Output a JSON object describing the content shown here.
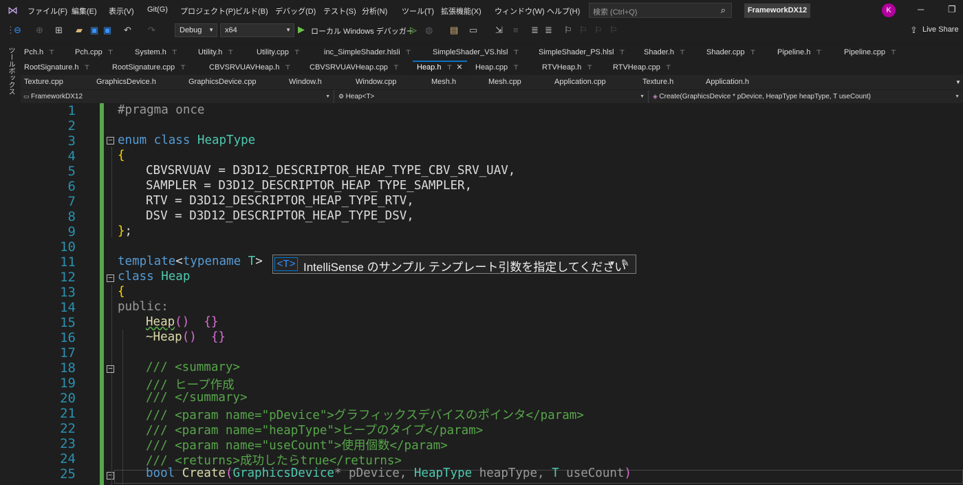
{
  "menu": {
    "items": [
      "ファイル(F)",
      "編集(E)",
      "表示(V)",
      "Git(G)",
      "プロジェクト(P)",
      "ビルド(B)",
      "デバッグ(D)",
      "テスト(S)",
      "分析(N)",
      "ツール(T)",
      "拡張機能(X)",
      "ウィンドウ(W)",
      "ヘルプ(H)"
    ],
    "search_placeholder": "検索 (Ctrl+Q)",
    "solution_name": "FrameworkDX12",
    "avatar_letter": "K"
  },
  "toolbar": {
    "config": "Debug",
    "platform": "x64",
    "run_label": "ローカル Windows デバッガー",
    "live_share": "Live Share"
  },
  "toolbox_label": "ツールボックス",
  "tabs": {
    "row1": [
      "Pch.h",
      "Pch.cpp",
      "System.h",
      "Utility.h",
      "Utility.cpp",
      "inc_SimpleShader.hlsli",
      "SimpleShader_VS.hlsl",
      "SimpleShader_PS.hlsl",
      "Shader.h",
      "Shader.cpp",
      "Pipeline.h",
      "Pipeline.cpp"
    ],
    "row2": [
      "RootSignature.h",
      "RootSignature.cpp",
      "CBVSRVUAVHeap.h",
      "CBVSRVUAVHeap.cpp",
      "Heap.h",
      "Heap.cpp",
      "RTVHeap.h",
      "RTVHeap.cpp"
    ],
    "row3": [
      "Texture.cpp",
      "GraphicsDevice.h",
      "GraphicsDevice.cpp",
      "Window.h",
      "Window.cpp",
      "Mesh.h",
      "Mesh.cpp",
      "Application.cpp",
      "Texture.h",
      "Application.h"
    ],
    "active": "Heap.h"
  },
  "navbar": {
    "project": "FrameworkDX12",
    "scope": "Heap<T>",
    "member": "Create(GraphicsDevice * pDevice, HeapType heapType, T useCount)"
  },
  "editor": {
    "line_numbers": [
      "1",
      "2",
      "3",
      "4",
      "5",
      "6",
      "7",
      "8",
      "9",
      "10",
      "11",
      "12",
      "13",
      "14",
      "15",
      "16",
      "17",
      "18",
      "19",
      "20",
      "21",
      "22",
      "23",
      "24",
      "25"
    ],
    "lines": {
      "l1": "#pragma once",
      "l3_kw": "enum class ",
      "l3_name": "HeapType",
      "l4": "{",
      "l5": "CBVSRVUAV = D3D12_DESCRIPTOR_HEAP_TYPE_CBV_SRV_UAV,",
      "l6": "SAMPLER = D3D12_DESCRIPTOR_HEAP_TYPE_SAMPLER,",
      "l7": "RTV = D3D12_DESCRIPTOR_HEAP_TYPE_RTV,",
      "l8": "DSV = D3D12_DESCRIPTOR_HEAP_TYPE_DSV,",
      "l9_brace": "}",
      "l9_semi": ";",
      "l11_kw1": "template",
      "l11_lt": "<",
      "l11_kw2": "typename ",
      "l11_t": "T",
      "l11_gt": ">",
      "l12_kw": "class ",
      "l12_name": "Heap",
      "l13": "{",
      "l14": "public:",
      "l15_fn": "Heap",
      "l15_paren": "()",
      "l15_body": "{}",
      "l16_fn": "~Heap",
      "l16_paren": "()",
      "l16_body": "{}",
      "l18": "/// <summary>",
      "l19": "/// ヒープ作成",
      "l20": "/// </summary>",
      "l21": "/// <param name=\"pDevice\">グラフィックスデバイスのポインタ</param>",
      "l22": "/// <param name=\"heapType\">ヒープのタイプ</param>",
      "l23": "/// <param name=\"useCount\">使用個数</param>",
      "l24": "/// <returns>成功したらtrue</returns>",
      "l25_bool": "bool ",
      "l25_fn": "Create",
      "l25_open": "(",
      "l25_t1": "GraphicsDevice",
      "l25_p1": "* pDevice, ",
      "l25_t2": "HeapType",
      "l25_p2": " heapType, ",
      "l25_t3": "T",
      "l25_p3": " useCount",
      "l25_close": ")"
    }
  },
  "intellisense": {
    "badge": "<T>",
    "message": "IntelliSense のサンプル テンプレート引数を指定してください"
  },
  "colors": {
    "keyword": "#569cd6",
    "type": "#4ec9b0",
    "comment": "#57a64a",
    "line_number": "#2b91af",
    "accent": "#0e70c0"
  }
}
